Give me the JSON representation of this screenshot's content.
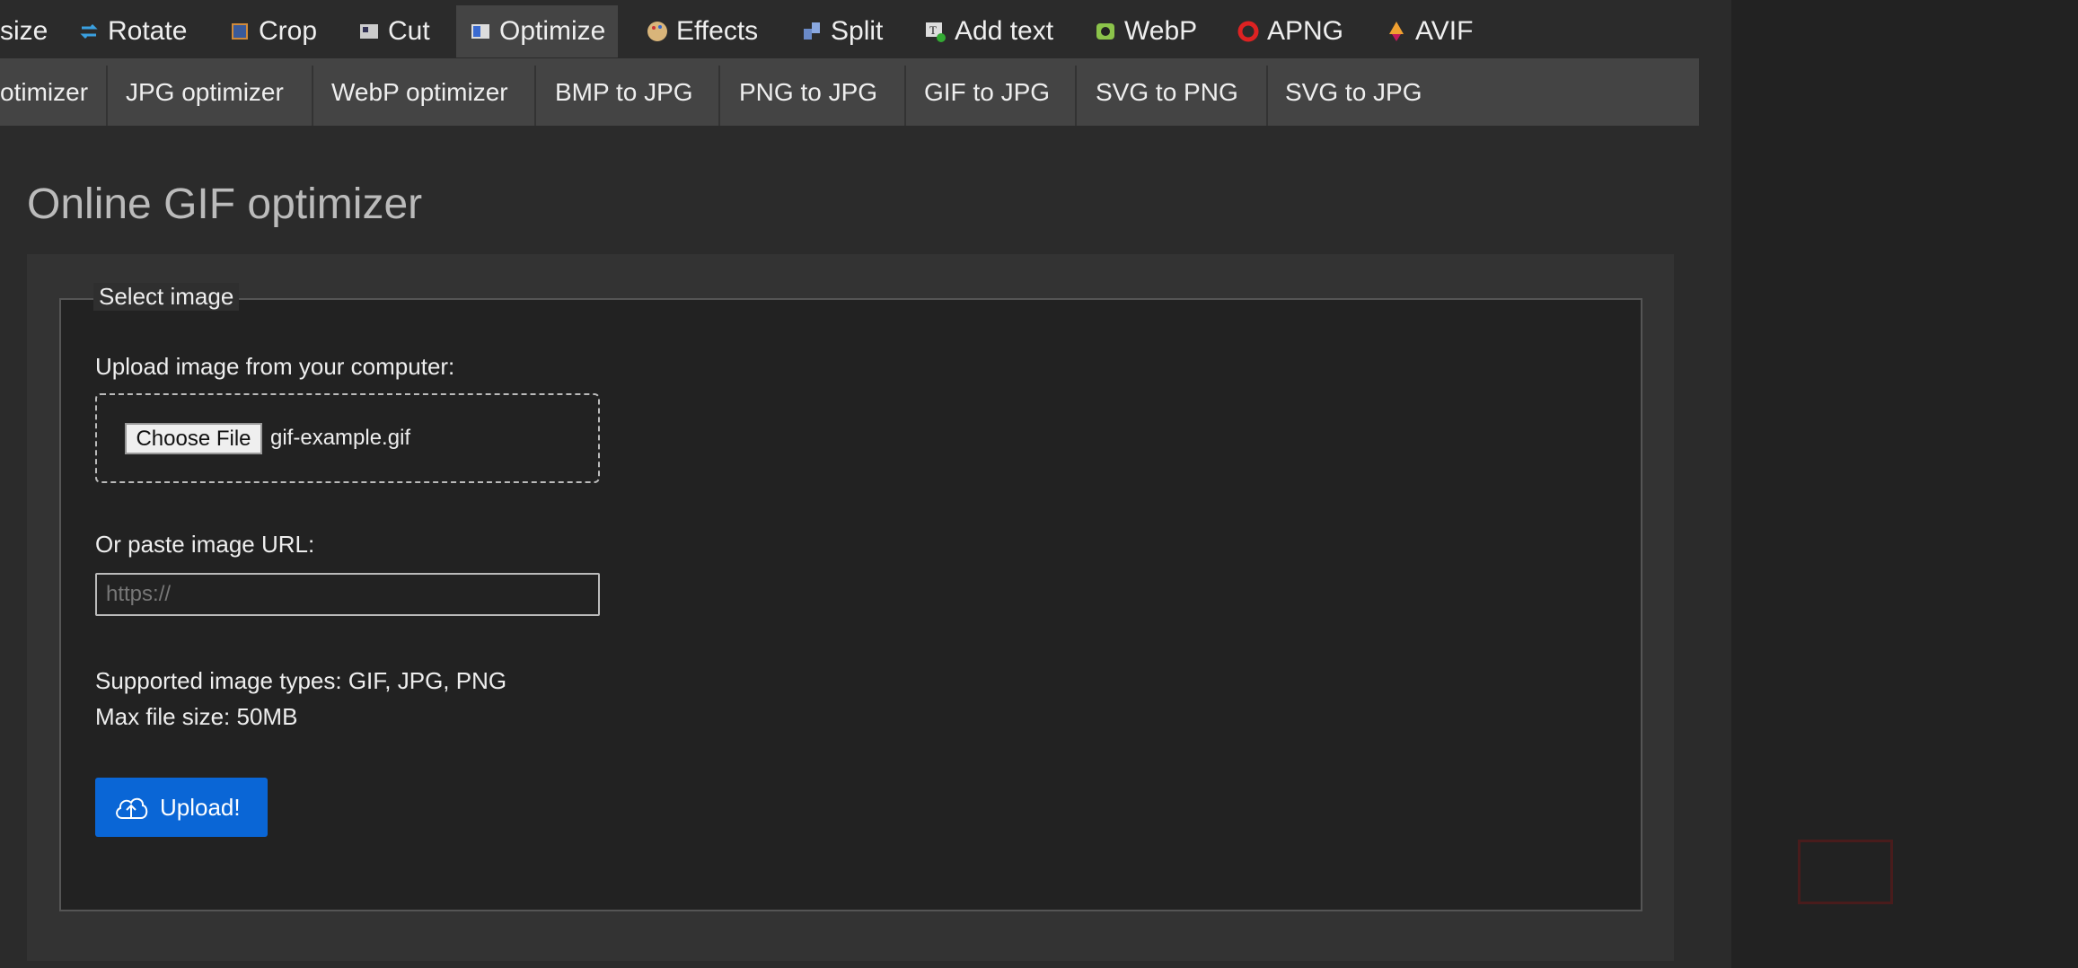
{
  "topnav": {
    "items": [
      {
        "label": "size",
        "icon": "resize-icon"
      },
      {
        "label": "Rotate",
        "icon": "rotate-icon"
      },
      {
        "label": "Crop",
        "icon": "crop-icon"
      },
      {
        "label": "Cut",
        "icon": "cut-icon"
      },
      {
        "label": "Optimize",
        "icon": "optimize-icon",
        "active": true
      },
      {
        "label": "Effects",
        "icon": "palette-icon"
      },
      {
        "label": "Split",
        "icon": "split-icon"
      },
      {
        "label": "Add text",
        "icon": "add-text-icon"
      },
      {
        "label": "WebP",
        "icon": "webp-icon"
      },
      {
        "label": "APNG",
        "icon": "apng-icon"
      },
      {
        "label": "AVIF",
        "icon": "avif-icon"
      }
    ]
  },
  "subnav": {
    "items": [
      "otimizer",
      "JPG optimizer",
      "WebP optimizer",
      "BMP to JPG",
      "PNG to JPG",
      "GIF to JPG",
      "SVG to PNG",
      "SVG to JPG"
    ]
  },
  "page": {
    "title": "Online GIF optimizer"
  },
  "form": {
    "legend": "Select image",
    "upload_label": "Upload image from your computer:",
    "choose_file": "Choose File",
    "filename": "gif-example.gif",
    "url_label": "Or paste image URL:",
    "url_placeholder": "https://",
    "url_value": "",
    "supported": "Supported image types: GIF, JPG, PNG",
    "max_size": "Max file size: 50MB",
    "upload_button": "Upload!"
  },
  "colors": {
    "accent": "#0a66d6",
    "background": "#2b2b2b",
    "panel": "#333333",
    "fieldset": "#222222"
  }
}
